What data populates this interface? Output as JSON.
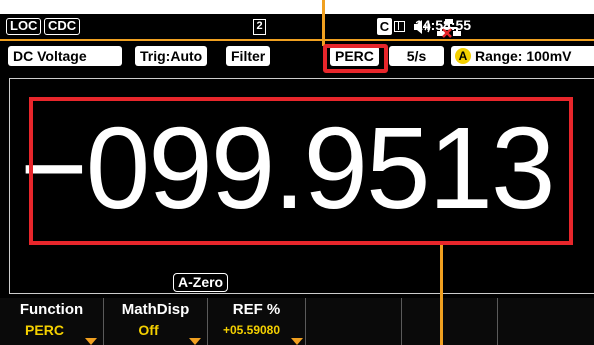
{
  "status": {
    "loc": "LOC",
    "cdc": "CDC",
    "channel": "2",
    "ce_letter": "C",
    "time": "14:58:55"
  },
  "mode_row": {
    "function_name": "DC Voltage",
    "trigger": "Trig:Auto",
    "filter": "Filter",
    "perc": "PERC",
    "rate": "5/s",
    "range_badge": "A",
    "range": "Range: 100mV"
  },
  "reading": {
    "value": "−099.9513",
    "azero": "A-Zero"
  },
  "softkeys": [
    {
      "label": "Function",
      "value": "PERC"
    },
    {
      "label": "MathDisp",
      "value": "Off"
    },
    {
      "label": "REF %",
      "value": "+05.59080"
    }
  ],
  "colors": {
    "accent_orange": "#f0a020",
    "callout_red": "#e8262b",
    "value_yellow": "#f4d000"
  }
}
